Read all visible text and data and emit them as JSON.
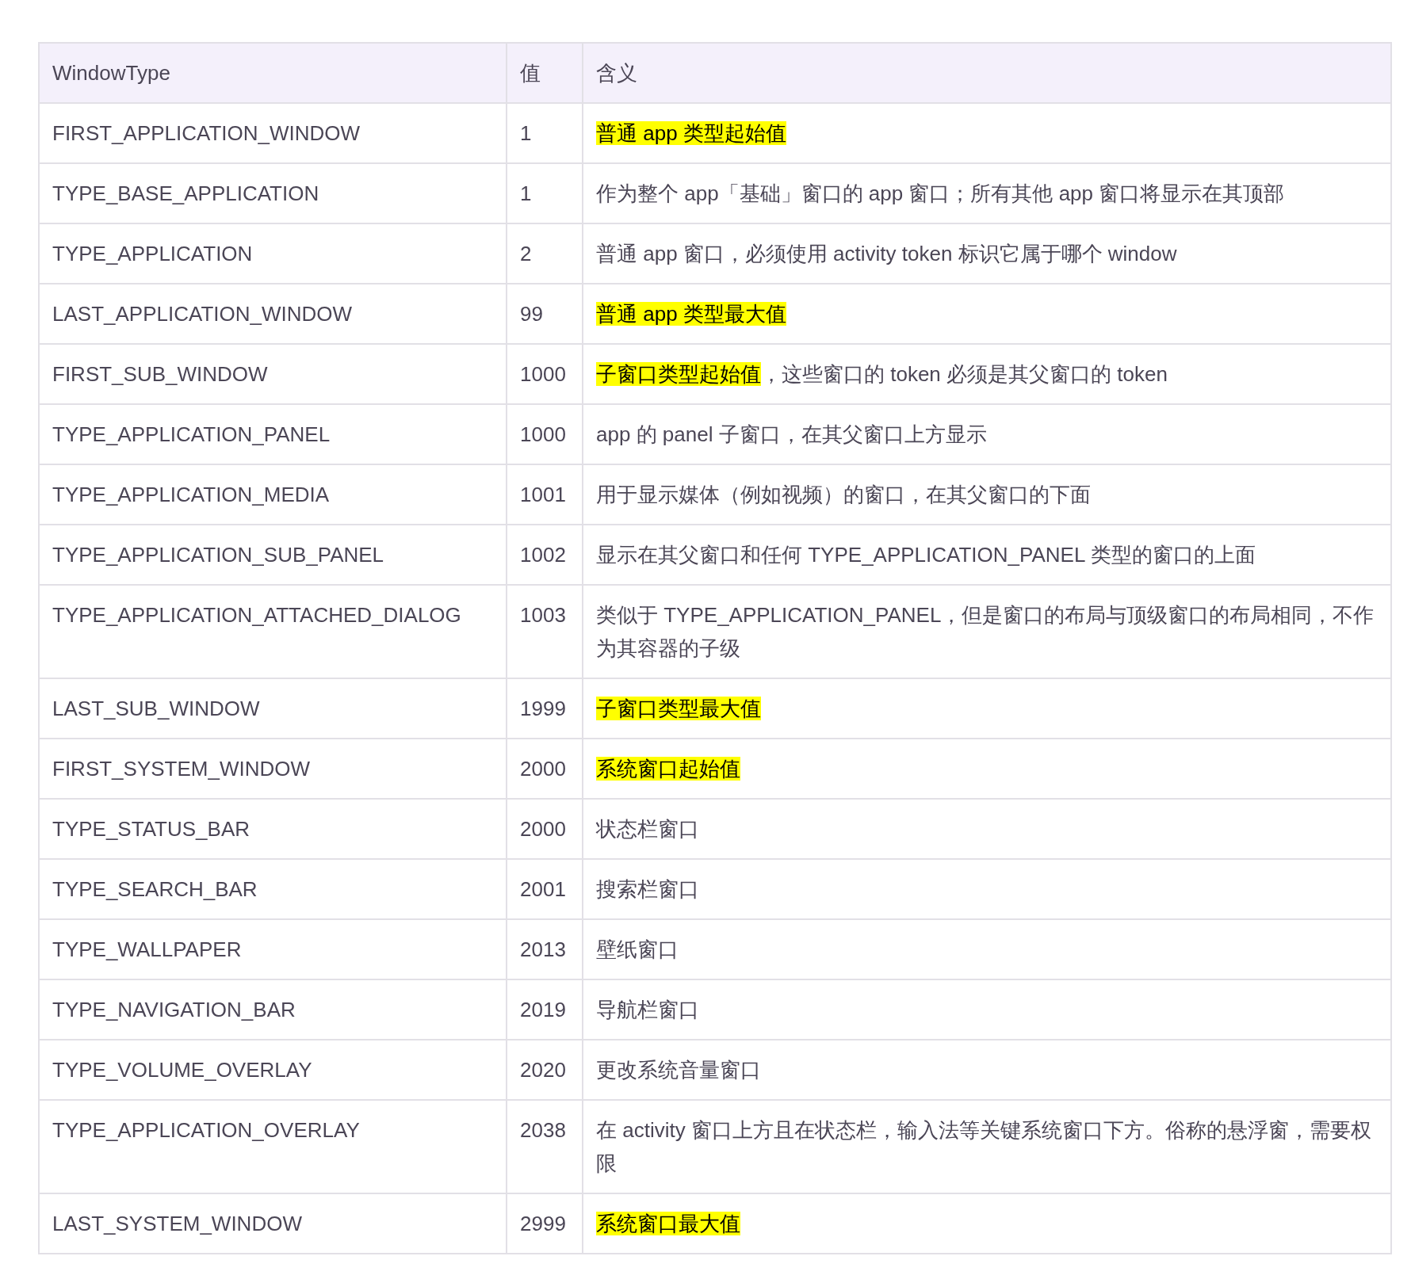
{
  "table": {
    "columns": [
      "WindowType",
      "值",
      "含义"
    ],
    "rows": [
      {
        "type": "FIRST_APPLICATION_WINDOW",
        "value": "1",
        "meaning": [
          {
            "text": "普通 app 类型起始值",
            "highlighted": true
          }
        ]
      },
      {
        "type": "TYPE_BASE_APPLICATION",
        "value": "1",
        "meaning": [
          {
            "text": "作为整个 app「基础」窗口的 app 窗口；所有其他 app 窗口将显示在其顶部",
            "highlighted": false
          }
        ]
      },
      {
        "type": "TYPE_APPLICATION",
        "value": "2",
        "meaning": [
          {
            "text": "普通 app 窗口，必须使用 activity token 标识它属于哪个 window",
            "highlighted": false
          }
        ]
      },
      {
        "type": "LAST_APPLICATION_WINDOW",
        "value": "99",
        "meaning": [
          {
            "text": "普通 app 类型最大值",
            "highlighted": true
          }
        ]
      },
      {
        "type": "FIRST_SUB_WINDOW",
        "value": "1000",
        "meaning": [
          {
            "text": "子窗口类型起始值",
            "highlighted": true
          },
          {
            "text": "，这些窗口的 token 必须是其父窗口的 token",
            "highlighted": false
          }
        ]
      },
      {
        "type": "TYPE_APPLICATION_PANEL",
        "value": "1000",
        "meaning": [
          {
            "text": "app 的 panel 子窗口，在其父窗口上方显示",
            "highlighted": false
          }
        ]
      },
      {
        "type": "TYPE_APPLICATION_MEDIA",
        "value": "1001",
        "meaning": [
          {
            "text": "用于显示媒体（例如视频）的窗口，在其父窗口的下面",
            "highlighted": false
          }
        ]
      },
      {
        "type": "TYPE_APPLICATION_SUB_PANEL",
        "value": "1002",
        "meaning": [
          {
            "text": "显示在其父窗口和任何 TYPE_APPLICATION_PANEL 类型的窗口的上面",
            "highlighted": false
          }
        ]
      },
      {
        "type": "TYPE_APPLICATION_ATTACHED_DIALOG",
        "value": "1003",
        "meaning": [
          {
            "text": "类似于 TYPE_APPLICATION_PANEL，但是窗口的布局与顶级窗口的布局相同，不作为其容器的子级",
            "highlighted": false
          }
        ]
      },
      {
        "type": "LAST_SUB_WINDOW",
        "value": "1999",
        "meaning": [
          {
            "text": "子窗口类型最大值",
            "highlighted": true
          }
        ]
      },
      {
        "type": "FIRST_SYSTEM_WINDOW",
        "value": "2000",
        "meaning": [
          {
            "text": "系统窗口起始值",
            "highlighted": true
          }
        ]
      },
      {
        "type": "TYPE_STATUS_BAR",
        "value": "2000",
        "meaning": [
          {
            "text": "状态栏窗口",
            "highlighted": false
          }
        ]
      },
      {
        "type": "TYPE_SEARCH_BAR",
        "value": "2001",
        "meaning": [
          {
            "text": "搜索栏窗口",
            "highlighted": false
          }
        ]
      },
      {
        "type": "TYPE_WALLPAPER",
        "value": "2013",
        "meaning": [
          {
            "text": "壁纸窗口",
            "highlighted": false
          }
        ]
      },
      {
        "type": "TYPE_NAVIGATION_BAR",
        "value": "2019",
        "meaning": [
          {
            "text": "导航栏窗口",
            "highlighted": false
          }
        ]
      },
      {
        "type": "TYPE_VOLUME_OVERLAY",
        "value": "2020",
        "meaning": [
          {
            "text": "更改系统音量窗口",
            "highlighted": false
          }
        ]
      },
      {
        "type": "TYPE_APPLICATION_OVERLAY",
        "value": "2038",
        "meaning": [
          {
            "text": "在 activity 窗口上方且在状态栏，输入法等关键系统窗口下方。俗称的悬浮窗，需要权限",
            "highlighted": false
          }
        ]
      },
      {
        "type": "LAST_SYSTEM_WINDOW",
        "value": "2999",
        "meaning": [
          {
            "text": "系统窗口最大值",
            "highlighted": true
          }
        ]
      }
    ]
  }
}
